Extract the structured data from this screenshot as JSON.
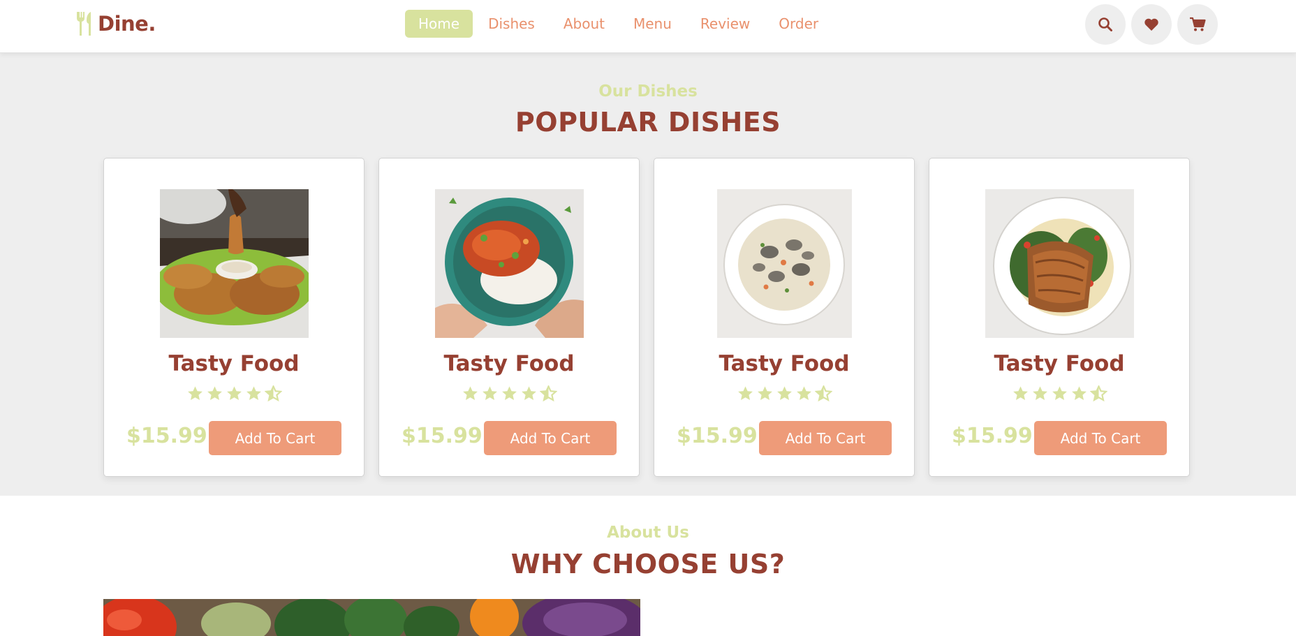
{
  "header": {
    "logo_text": "Dine.",
    "nav": [
      {
        "label": "Home",
        "active": true
      },
      {
        "label": "Dishes",
        "active": false
      },
      {
        "label": "About",
        "active": false
      },
      {
        "label": "Menu",
        "active": false
      },
      {
        "label": "Review",
        "active": false
      },
      {
        "label": "Order",
        "active": false
      }
    ],
    "icons": [
      "search-icon",
      "heart-icon",
      "cart-icon"
    ]
  },
  "dishes": {
    "subtitle": "Our Dishes",
    "title": "POPULAR DISHES",
    "cards": [
      {
        "image": "fried-chicken-tenders-image",
        "name": "Tasty Food",
        "rating": 4.5,
        "price": "$15.99",
        "button": "Add To Cart"
      },
      {
        "image": "chicken-rice-bowl-image",
        "name": "Tasty Food",
        "rating": 4.5,
        "price": "$15.99",
        "button": "Add To Cart"
      },
      {
        "image": "clam-chowder-image",
        "name": "Tasty Food",
        "rating": 4.5,
        "price": "$15.99",
        "button": "Add To Cart"
      },
      {
        "image": "seared-salmon-image",
        "name": "Tasty Food",
        "rating": 4.5,
        "price": "$15.99",
        "button": "Add To Cart"
      }
    ]
  },
  "about": {
    "subtitle": "About Us",
    "title": "WHY CHOOSE US?"
  },
  "colors": {
    "brand": "#964032",
    "accent_green": "#d8e29e",
    "accent_orange": "#ee9b79",
    "section_bg": "#eeeeee"
  }
}
